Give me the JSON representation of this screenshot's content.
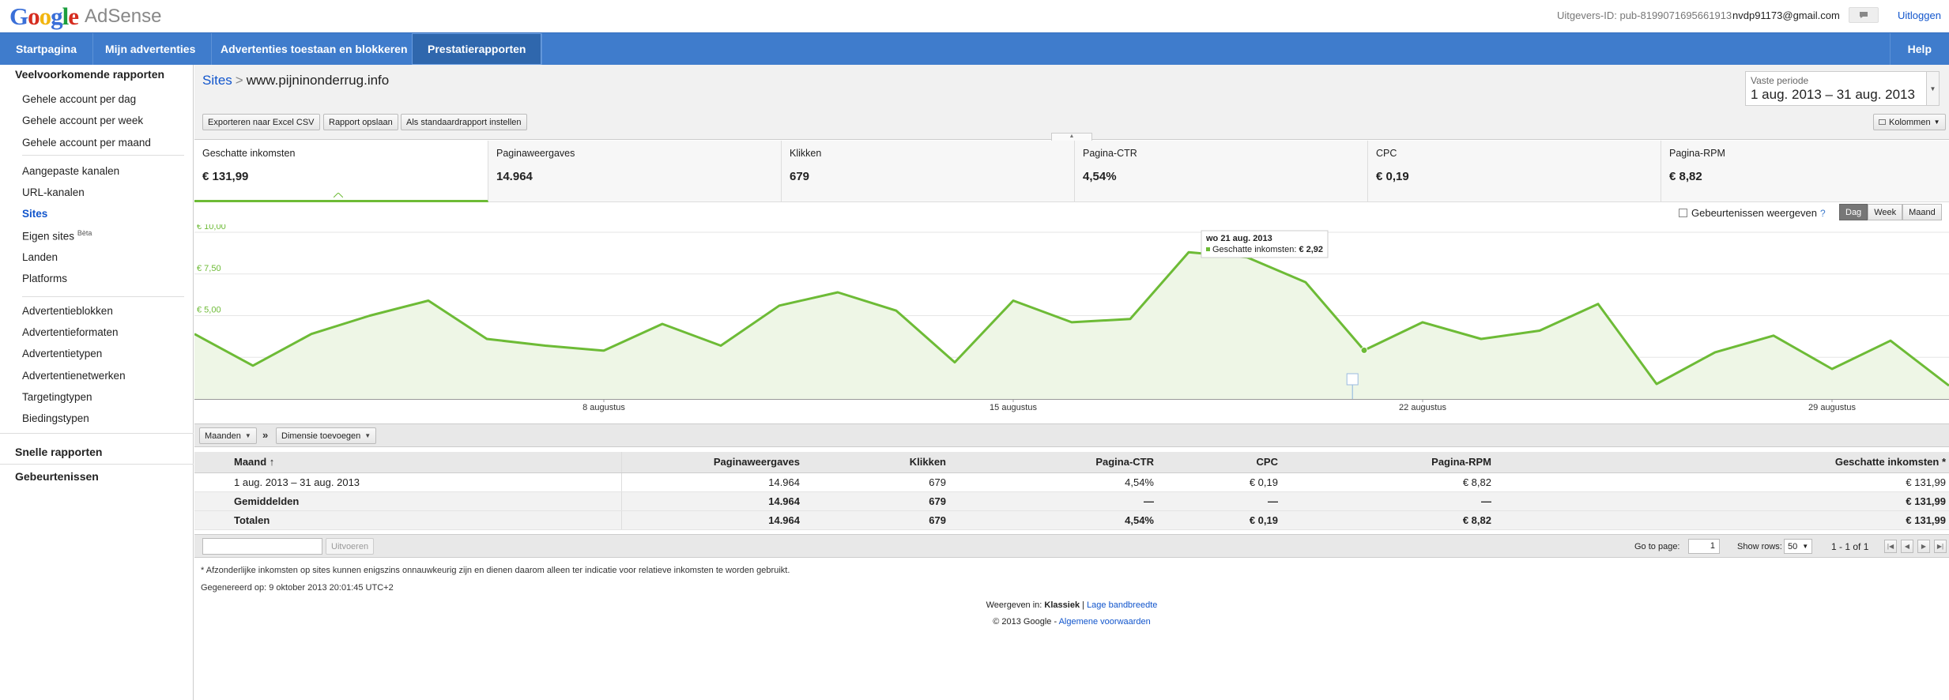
{
  "header": {
    "logo_letters": [
      "G",
      "o",
      "o",
      "g",
      "l",
      "e"
    ],
    "product": "AdSense",
    "publisher_id": "Uitgevers-ID: pub-8199071695661913",
    "user_email": "nvdp91173@gmail.com",
    "feedback_icon": "chat-icon",
    "logout_label": "Uitloggen"
  },
  "nav": {
    "tabs": [
      {
        "label": "Startpagina"
      },
      {
        "label": "Mijn advertenties"
      },
      {
        "label": "Advertenties toestaan en blokkeren"
      },
      {
        "label": "Prestatierapporten"
      }
    ],
    "active_tab": "Prestatierapporten",
    "help_label": "Help"
  },
  "sidebar": {
    "common_heading": "Veelvoorkomende rapporten",
    "items": [
      {
        "label": "Gehele account per dag"
      },
      {
        "label": "Gehele account per week"
      },
      {
        "label": "Gehele account per maand"
      },
      {
        "label": "Aangepaste kanalen"
      },
      {
        "label": "URL-kanalen"
      },
      {
        "label": "Sites"
      },
      {
        "label": "Eigen sites",
        "badge": "Bèta"
      },
      {
        "label": "Landen"
      },
      {
        "label": "Platforms"
      },
      {
        "label": "Advertentieblokken"
      },
      {
        "label": "Advertentieformaten"
      },
      {
        "label": "Advertentietypen"
      },
      {
        "label": "Advertentienetwerken"
      },
      {
        "label": "Targetingtypen"
      },
      {
        "label": "Biedingstypen"
      }
    ],
    "active_item": "Sites",
    "quick_reports": "Snelle rapporten",
    "events": "Gebeurtenissen"
  },
  "breadcrumb": {
    "parent": "Sites",
    "separator": ">",
    "current": "www.pijninonderrug.info"
  },
  "period": {
    "label": "Vaste periode",
    "value": "1 aug. 2013 – 31 aug. 2013"
  },
  "toolbar": {
    "export_label": "Exporteren naar Excel CSV",
    "save_label": "Rapport opslaan",
    "default_label": "Als standaardrapport instellen",
    "columns_label": "Kolommen"
  },
  "metrics": [
    {
      "name": "Geschatte inkomsten",
      "value": "€ 131,99",
      "active": true
    },
    {
      "name": "Paginaweergaves",
      "value": "14.964"
    },
    {
      "name": "Klikken",
      "value": "679"
    },
    {
      "name": "Pagina-CTR",
      "value": "4,54%"
    },
    {
      "name": "CPC",
      "value": "€ 0,19"
    },
    {
      "name": "Pagina-RPM",
      "value": "€ 8,82"
    }
  ],
  "chart_controls": {
    "events_label": "Gebeurtenissen weergeven",
    "help_glyph": "?",
    "granularity": [
      "Dag",
      "Week",
      "Maand"
    ],
    "active_granularity": "Dag"
  },
  "chart_data": {
    "type": "area",
    "x": [
      "2013-08-01",
      "2013-08-02",
      "2013-08-03",
      "2013-08-04",
      "2013-08-05",
      "2013-08-06",
      "2013-08-07",
      "2013-08-08",
      "2013-08-09",
      "2013-08-10",
      "2013-08-11",
      "2013-08-12",
      "2013-08-13",
      "2013-08-14",
      "2013-08-15",
      "2013-08-16",
      "2013-08-17",
      "2013-08-18",
      "2013-08-19",
      "2013-08-20",
      "2013-08-21",
      "2013-08-22",
      "2013-08-23",
      "2013-08-24",
      "2013-08-25",
      "2013-08-26",
      "2013-08-27",
      "2013-08-28",
      "2013-08-29",
      "2013-08-30",
      "2013-08-31"
    ],
    "series": [
      {
        "values": [
          3.9,
          2.0,
          3.9,
          5.0,
          5.9,
          3.6,
          3.2,
          2.9,
          4.5,
          3.2,
          5.6,
          6.4,
          5.3,
          2.2,
          5.9,
          4.6,
          4.8,
          8.8,
          8.5,
          7.0,
          2.92,
          4.6,
          3.6,
          4.1,
          5.7,
          0.9,
          2.8,
          3.8,
          1.8,
          3.5,
          0.8
        ]
      }
    ],
    "y_ticks": [
      "€ 10,00",
      "€ 7,50",
      "€ 5,00",
      "€ 2,50"
    ],
    "x_ticks": [
      {
        "label": "8 augustus",
        "day": 8
      },
      {
        "label": "15 augustus",
        "day": 15
      },
      {
        "label": "22 augustus",
        "day": 22
      },
      {
        "label": "29 augustus",
        "day": 29
      }
    ],
    "ylim": [
      0,
      10
    ],
    "grid": true,
    "tooltip": {
      "date": "wo 21 aug. 2013",
      "series": "Geschatte inkomsten:",
      "value": "€ 2,92",
      "day": 21
    },
    "color": "#6dbb36",
    "fill": "#eef6e6"
  },
  "table_controls": {
    "dimension_label": "Maanden",
    "separator": "»",
    "add_dimension_label": "Dimensie toevoegen"
  },
  "table": {
    "columns": [
      "Maand ↑",
      "Paginaweergaves",
      "Klikken",
      "Pagina-CTR",
      "CPC",
      "Pagina-RPM",
      "Geschatte inkomsten *"
    ],
    "rows": [
      [
        "1 aug. 2013 – 31 aug. 2013",
        "14.964",
        "679",
        "4,54%",
        "€ 0,19",
        "€ 8,82",
        "€ 131,99"
      ]
    ],
    "averages": [
      "Gemiddelden",
      "14.964",
      "679",
      "—",
      "—",
      "—",
      "€ 131,99"
    ],
    "totals": [
      "Totalen",
      "14.964",
      "679",
      "4,54%",
      "€ 0,19",
      "€ 8,82",
      "€ 131,99"
    ]
  },
  "pager": {
    "run_label": "Uitvoeren",
    "goto_label": "Go to page:",
    "goto_value": "1",
    "show_rows_label": "Show rows:",
    "rows_value": "50",
    "range": "1 - 1 of 1"
  },
  "footer": {
    "footnote": "* Afzonderlijke inkomsten op sites kunnen enigszins onnauwkeurig zijn en dienen daarom alleen ter indicatie voor relatieve inkomsten te worden gebruikt.",
    "generated": "Gegenereerd op: 9 oktober 2013 20:01:45 UTC+2",
    "view_in": "Weergeven in:",
    "view_classic": "Klassiek",
    "view_sep": "|",
    "view_low": "Lage bandbreedte",
    "copyright": "© 2013 Google -",
    "terms": "Algemene voorwaarden"
  }
}
